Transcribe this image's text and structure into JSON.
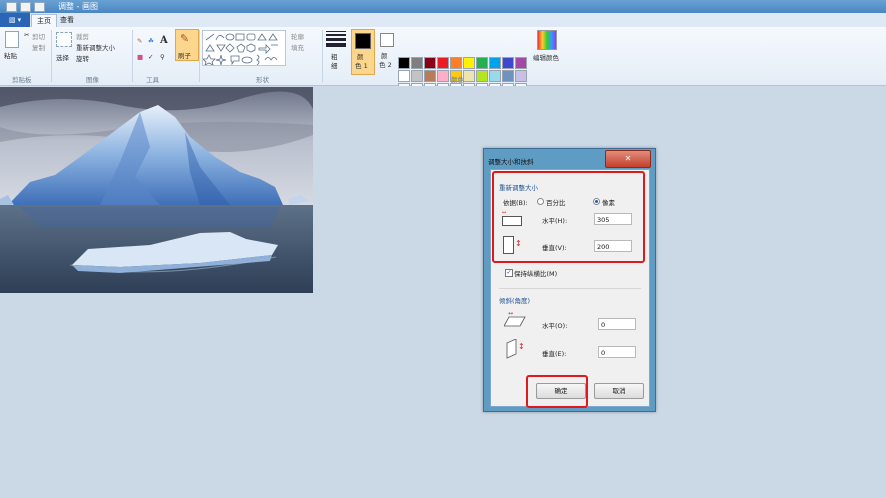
{
  "window": {
    "title": "调整 - 画图"
  },
  "tabs": {
    "file": "",
    "home": "主页",
    "view": "查看"
  },
  "clipboard": {
    "paste": "粘贴",
    "cut": "剪切",
    "copy": "复制",
    "group": "剪贴板"
  },
  "image_group": {
    "select": "选择",
    "crop": "裁剪",
    "resize": "重新调整大小",
    "rotate": "旋转",
    "group": "图像"
  },
  "tools_group": {
    "text_tool": "A",
    "group": "工具"
  },
  "brushes": {
    "label": "刷子"
  },
  "shapes_group": {
    "outline": "轮廓",
    "fill": "填充",
    "group": "形状"
  },
  "size_btn": {
    "label1": "粗",
    "label2": "细"
  },
  "colors_group": {
    "color1_line1": "颜",
    "color1_line2": "色 1",
    "color2_line1": "颜",
    "color2_line2": "色 2",
    "edit": "编辑颜色",
    "group": "颜色",
    "color1_value": "#000000",
    "color2_value": "#ffffff",
    "palette_row1": [
      "#000000",
      "#7f7f7f",
      "#880015",
      "#ed1c24",
      "#ff7f27",
      "#fff200",
      "#22b14c",
      "#00a2e8",
      "#3f48cc",
      "#a349a4"
    ],
    "palette_row2": [
      "#ffffff",
      "#c3c3c3",
      "#b97a57",
      "#ffaec9",
      "#ffc90e",
      "#efe4b0",
      "#b5e61d",
      "#99d9ea",
      "#7092be",
      "#c8bfe7"
    ]
  },
  "dialog": {
    "title": "调整大小和扶斜",
    "close": "✕",
    "resize_section": "重新调整大小",
    "basis_label": "依据(B):",
    "percent_option": "百分比",
    "pixel_option": "像素",
    "horizontal_label": "水平(H):",
    "horizontal_value": "305",
    "vertical_label": "垂直(V):",
    "vertical_value": "200",
    "keep_ratio_label": "保持纵横比(M)",
    "skew_section": "倾斜(角度)",
    "skew_h_label": "水平(O):",
    "skew_h_value": "0",
    "skew_v_label": "垂直(E):",
    "skew_v_value": "0",
    "ok": "确定",
    "cancel": "取消",
    "check_mark": "✓"
  }
}
